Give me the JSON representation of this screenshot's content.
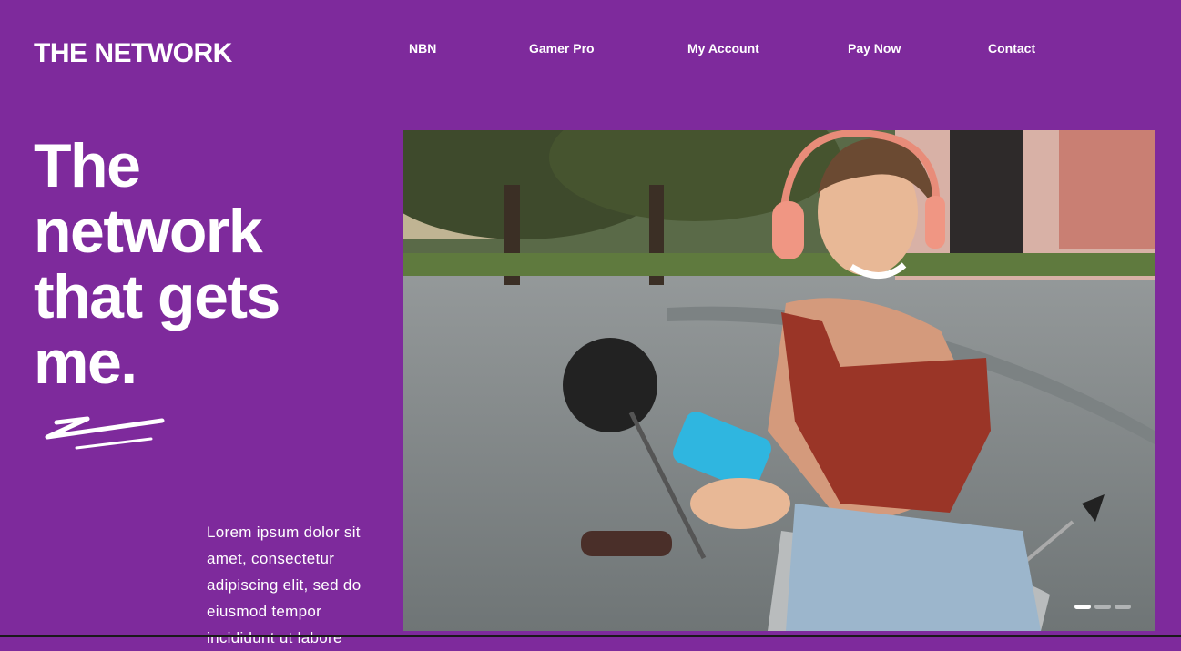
{
  "brand": {
    "logo": "THE NETWORK"
  },
  "nav": {
    "items": [
      {
        "label": "NBN"
      },
      {
        "label": "Gamer Pro"
      },
      {
        "label": "My Account"
      },
      {
        "label": "Pay Now"
      },
      {
        "label": "Contact"
      }
    ]
  },
  "hero": {
    "headline_lines": [
      "The",
      "network",
      "that gets",
      "me."
    ],
    "body": "Lorem ipsum dolor sit amet, consectetur adipiscing elit, sed do eiusmod tempor incididunt ut labore",
    "carousel": {
      "slides": 3,
      "active": 1
    }
  },
  "colors": {
    "background": "#7e2a9c",
    "text": "#ffffff"
  }
}
